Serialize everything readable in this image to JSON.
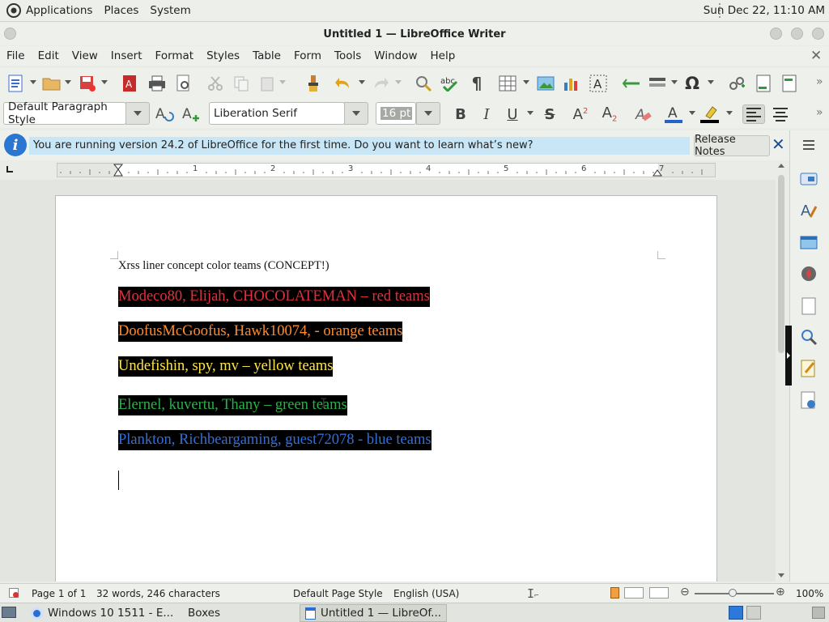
{
  "panel": {
    "applications": "Applications",
    "places": "Places",
    "system": "System",
    "clock": "Sun Dec 22, 11:10 AM"
  },
  "window": {
    "title": "Untitled 1 — LibreOffice Writer"
  },
  "menubar": [
    "File",
    "Edit",
    "View",
    "Insert",
    "Format",
    "Styles",
    "Table",
    "Form",
    "Tools",
    "Window",
    "Help"
  ],
  "format_toolbar": {
    "paragraph_style": "Default Paragraph Style",
    "font_name": "Liberation Serif",
    "font_size": "16 pt"
  },
  "infobar": {
    "message": "You are running version 24.2 of LibreOffice for the first time. Do you want to learn what’s new?",
    "release_notes": "Release Notes"
  },
  "ruler": {
    "numbers": [
      "1",
      "2",
      "3",
      "4",
      "5",
      "6",
      "7"
    ]
  },
  "document": {
    "title_line": "Xrss liner concept color teams (CONCEPT!)",
    "lines": [
      {
        "text": "Modeco80, Elijah, CHOCOLATEMAN – red teams",
        "color": "#e0323c"
      },
      {
        "text": "DoofusMcGoofus, Hawk10074,  - orange teams",
        "color": "#ff8a2a"
      },
      {
        "text": "Undefishin, spy, mv – yellow teams",
        "color": "#ffe44a"
      },
      {
        "text": "Elernel, kuvertu, Thany – green teams",
        "color": "#2cb14a"
      },
      {
        "text": "Plankton, Richbeargaming, guest72078 - blue teams",
        "color": "#3370d6"
      }
    ],
    "highlight_color": "#000000"
  },
  "statusbar": {
    "page": "Page 1 of 1",
    "words": "32 words, 246 characters",
    "page_style": "Default Page Style",
    "language": "English (USA)",
    "zoom": "100%"
  },
  "taskbar": {
    "items": [
      "Windows 10 1511 - E...",
      "Boxes",
      "Untitled 1 — LibreOf..."
    ]
  }
}
